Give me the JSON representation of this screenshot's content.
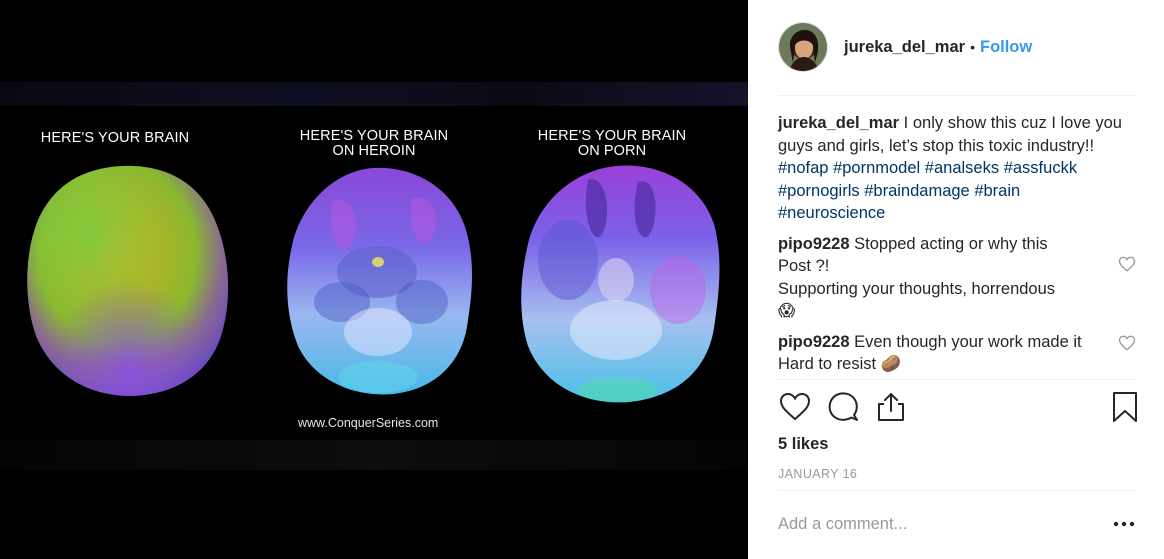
{
  "media": {
    "captions": [
      "HERE'S YOUR BRAIN",
      "HERE'S YOUR BRAIN\nON HEROIN",
      "HERE'S YOUR BRAIN\nON PORN"
    ],
    "watermark": "www.ConquerSeries.com"
  },
  "post": {
    "author": "jureka_del_mar",
    "separator": "•",
    "follow_label": "Follow",
    "caption_text": "I only show this cuz I love you guys and girls, let’s stop this toxic industry!!",
    "hashtags": [
      "#nofap",
      "#pornmodel",
      "#analseks",
      "#assfuckk",
      "#pornogirls",
      "#braindamage",
      "#brain",
      "#neuroscience"
    ]
  },
  "comments": [
    {
      "user": "pipo9228",
      "text": "Stopped acting or why this Post ?!",
      "text2": "Supporting your thoughts, horrendous",
      "emoji": "😱"
    },
    {
      "user": "pipo9228",
      "text": "Even though your work made it Hard to resist",
      "emoji": "🥔"
    }
  ],
  "likes": "5 likes",
  "date": "JANUARY 16",
  "add_comment_placeholder": "Add a comment...",
  "icons": [
    "heart-icon",
    "comment-icon",
    "share-icon",
    "bookmark-icon",
    "more-options-icon"
  ],
  "colors": {
    "link": "#3897f0",
    "hashtag": "#003569",
    "muted": "#999999"
  }
}
